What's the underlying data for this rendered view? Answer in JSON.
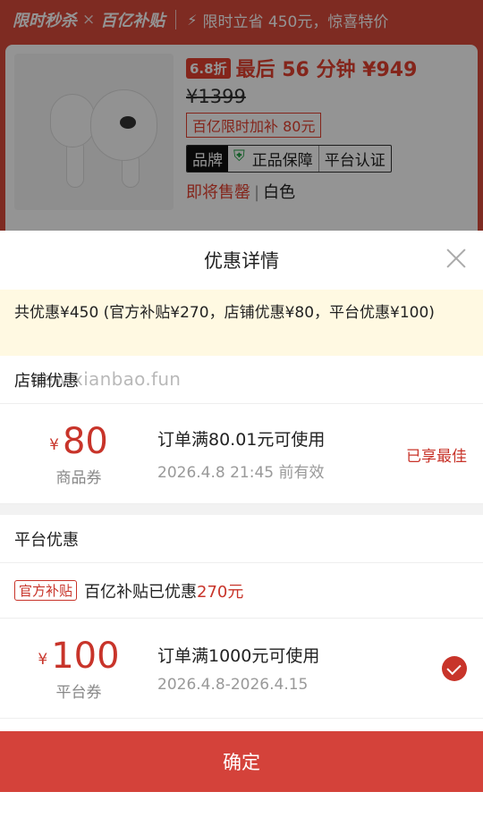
{
  "background": {
    "promo": {
      "brand1": "限时秒杀",
      "x": "×",
      "brand2": "百亿补贴",
      "text": "限时立省 450元，惊喜特价"
    },
    "product": {
      "discount_badge": "6.8折",
      "countdown_price": "最后 56 分钟 ¥949",
      "original_price": "¥1399",
      "subsidy": "百亿限时加补 80元",
      "badges": {
        "brand": "品牌",
        "guarantee": "正品保障",
        "certified": "平台认证"
      },
      "stock_status": "即将售罄",
      "color": "白色"
    }
  },
  "sheet": {
    "title": "优惠详情",
    "summary": "共优惠¥450 (官方补贴¥270，店铺优惠¥80，平台优惠¥100)",
    "store_section": {
      "label": "店铺优惠",
      "watermark": "new.xianbao.fun",
      "coupon": {
        "currency": "¥",
        "amount": "80",
        "type": "商品券",
        "condition": "订单满80.01元可使用",
        "expiry": "2026.4.8 21:45 前有效",
        "status": "已享最佳"
      }
    },
    "platform_section": {
      "label": "平台优惠",
      "subsidy_tag": "官方补贴",
      "subsidy_text": "百亿补贴已优惠",
      "subsidy_amount": "270元",
      "coupon": {
        "currency": "¥",
        "amount": "100",
        "type": "平台券",
        "condition": "订单满1000元可使用",
        "expiry": "2026.4.8-2026.4.15",
        "selected": true
      }
    },
    "confirm_label": "确定"
  },
  "colors": {
    "accent": "#c8342a",
    "confirm": "#d4423a",
    "summary_bg": "#fff9e2"
  }
}
